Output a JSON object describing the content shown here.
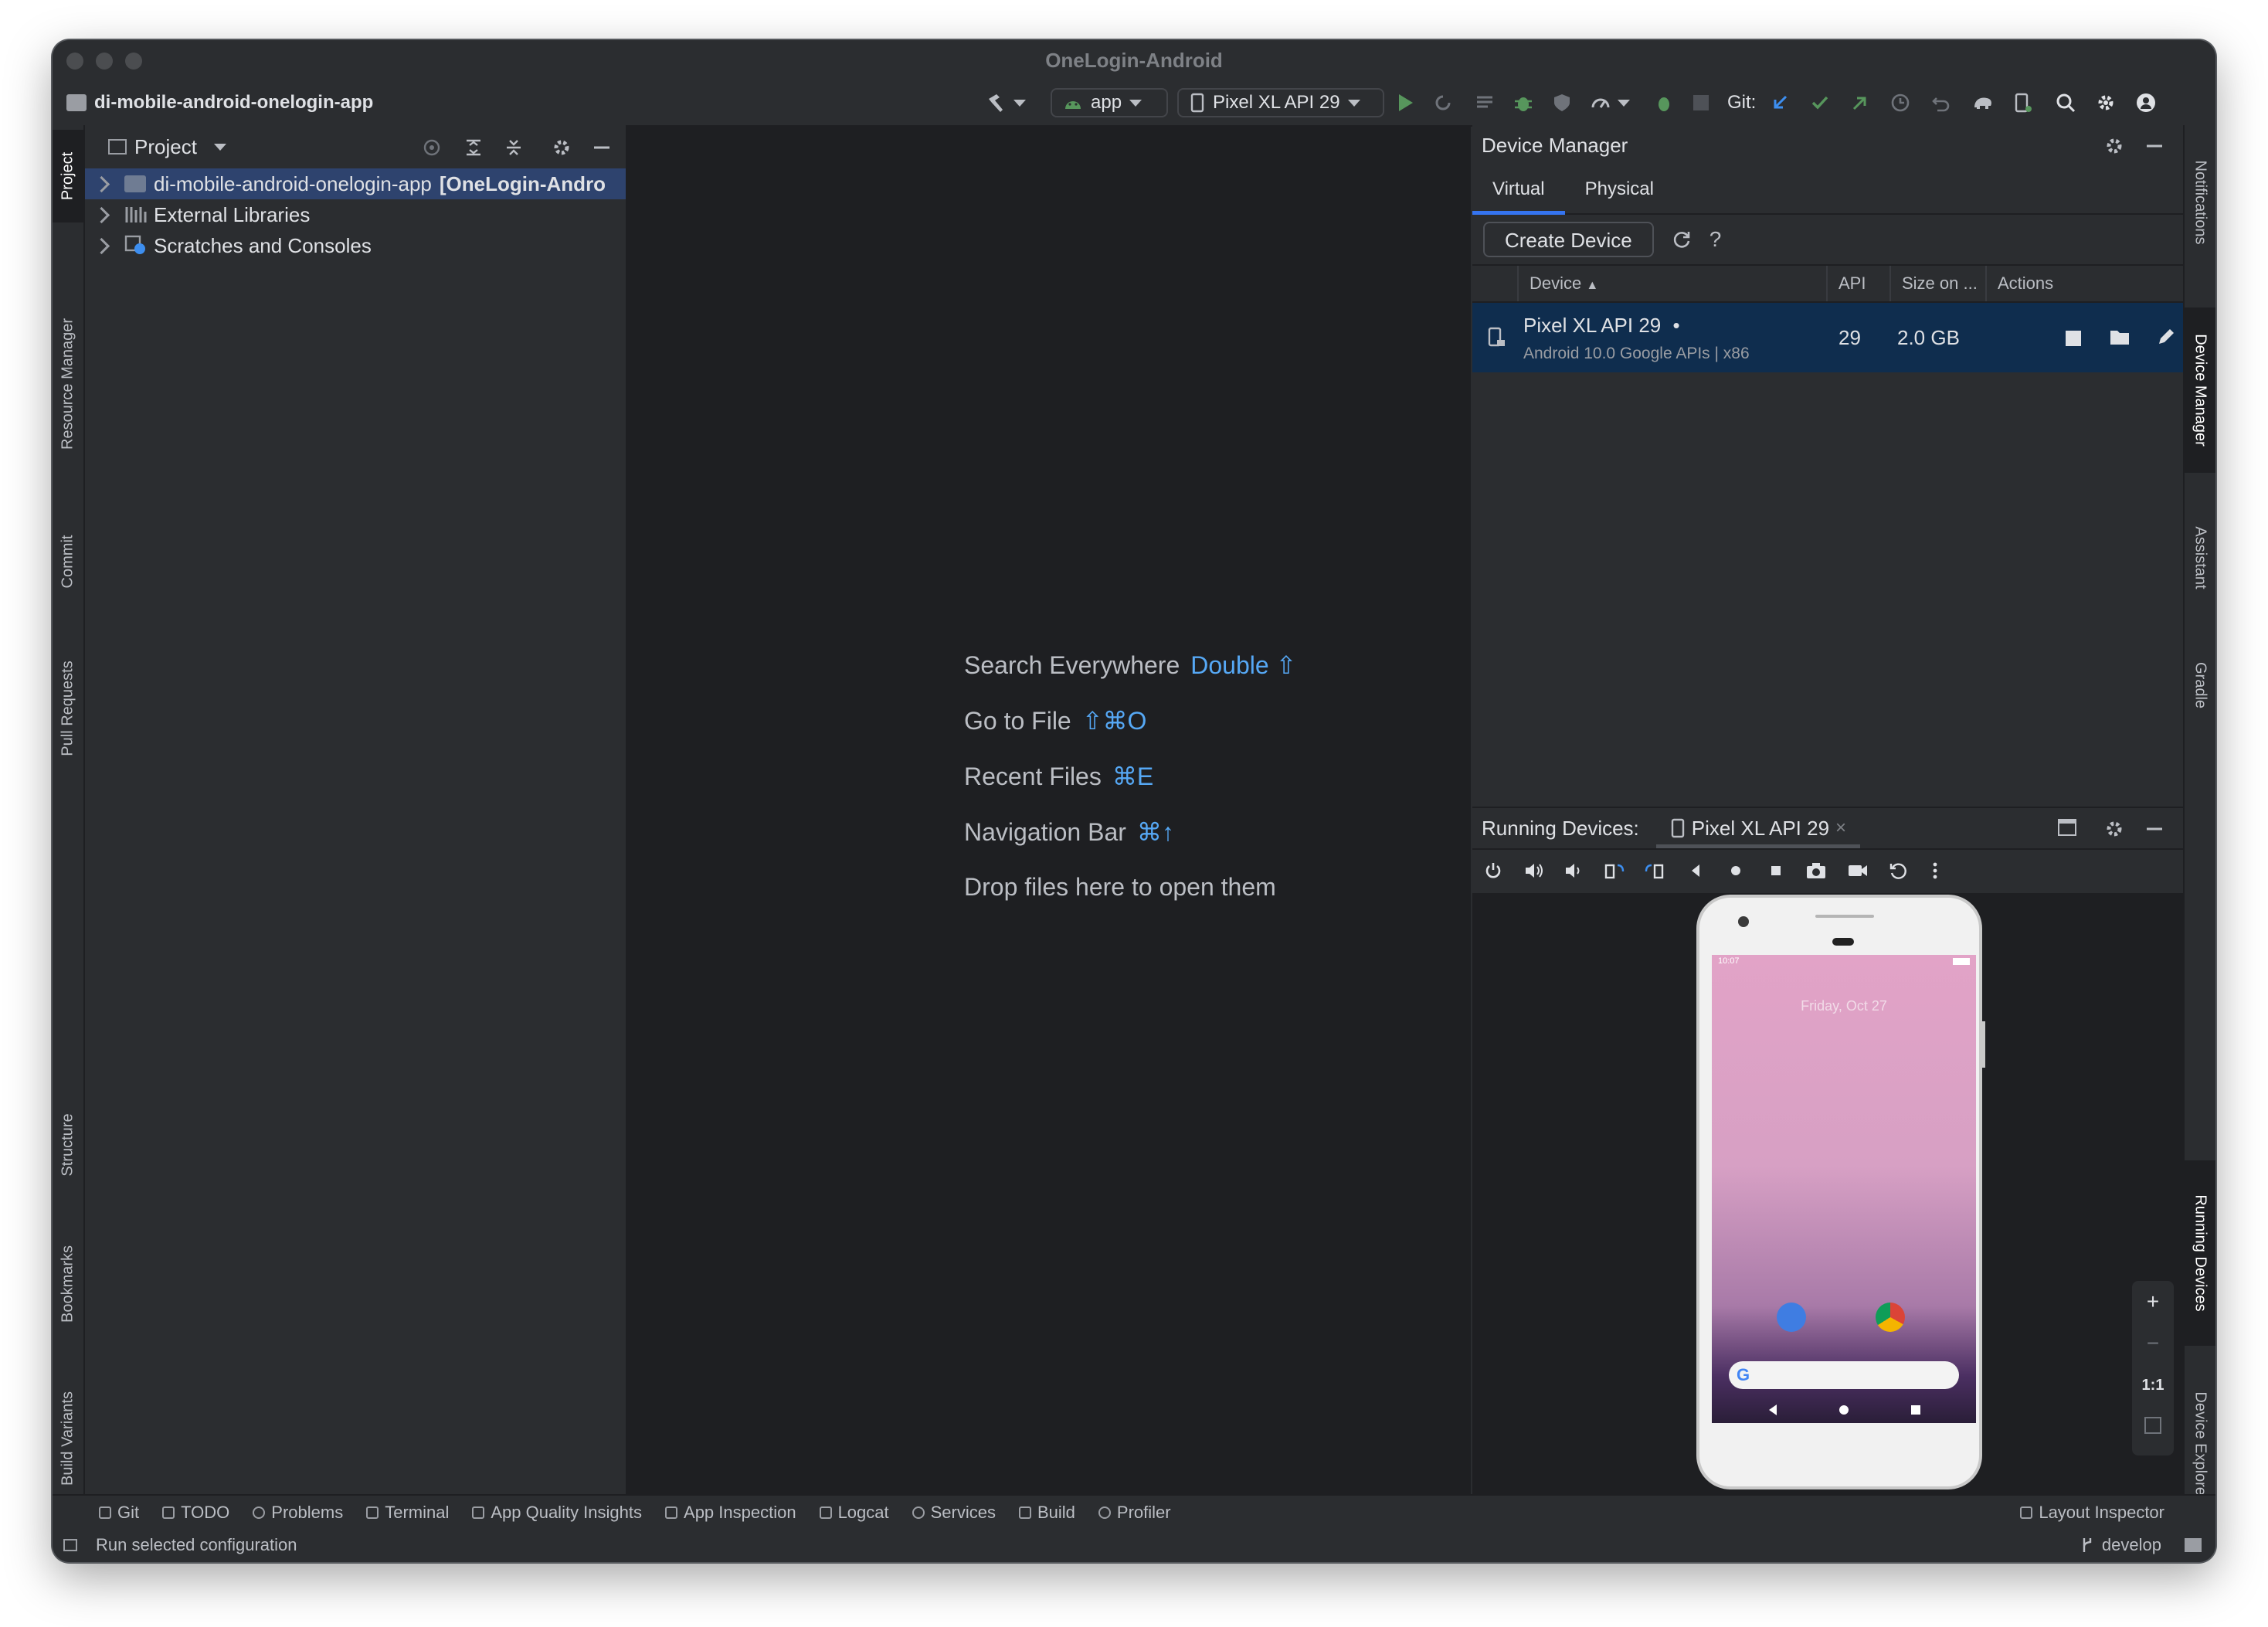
{
  "window": {
    "title": "OneLogin-Android"
  },
  "toolbar": {
    "project_name": "di-mobile-android-onelogin-app",
    "run_config": "app",
    "device": "Pixel XL API 29",
    "git_label": "Git:"
  },
  "left_strip": [
    "Project",
    "Resource Manager",
    "Commit",
    "Pull Requests",
    "Structure",
    "Bookmarks",
    "Build Variants"
  ],
  "right_strip": [
    "Notifications",
    "Device Manager",
    "Assistant",
    "Gradle",
    "Running Devices",
    "Device Explorer"
  ],
  "project_panel": {
    "title": "Project",
    "tree": [
      {
        "name": "di-mobile-android-onelogin-app",
        "suffix": "[OneLogin-Andro",
        "selected": true
      },
      {
        "name": "External Libraries",
        "suffix": ""
      },
      {
        "name": "Scratches and Consoles",
        "suffix": ""
      }
    ]
  },
  "editor_hints": [
    {
      "label": "Search Everywhere",
      "key": "Double ⇧"
    },
    {
      "label": "Go to File",
      "key": "⇧⌘O"
    },
    {
      "label": "Recent Files",
      "key": "⌘E"
    },
    {
      "label": "Navigation Bar",
      "key": "⌘↑"
    },
    {
      "label": "Drop files here to open them",
      "key": ""
    }
  ],
  "device_manager": {
    "title": "Device Manager",
    "tabs": [
      "Virtual",
      "Physical"
    ],
    "active_tab": "Virtual",
    "create_button": "Create Device",
    "help": "?",
    "columns": [
      "Device",
      "API",
      "Size on ...",
      "Actions"
    ],
    "devices": [
      {
        "name": "Pixel XL API 29",
        "running_dot": "•",
        "sub": "Android 10.0 Google APIs | x86",
        "api": "29",
        "size": "2.0 GB"
      }
    ]
  },
  "running_devices": {
    "label": "Running Devices:",
    "tab": "Pixel XL API 29",
    "close": "×",
    "phone": {
      "status_time": "10:07",
      "date": "Friday, Oct 27"
    },
    "zoom": {
      "plus": "+",
      "minus": "−",
      "one_to_one": "1:1"
    }
  },
  "bottom_tools": [
    "Git",
    "TODO",
    "Problems",
    "Terminal",
    "App Quality Insights",
    "App Inspection",
    "Logcat",
    "Services",
    "Build",
    "Profiler"
  ],
  "layout_inspector": "Layout Inspector",
  "status": {
    "message": "Run selected configuration",
    "branch": "develop"
  },
  "colors": {
    "accent": "#3574f0",
    "run_green": "#57965c",
    "key_blue": "#56a8f5",
    "selection": "#2e436e"
  }
}
